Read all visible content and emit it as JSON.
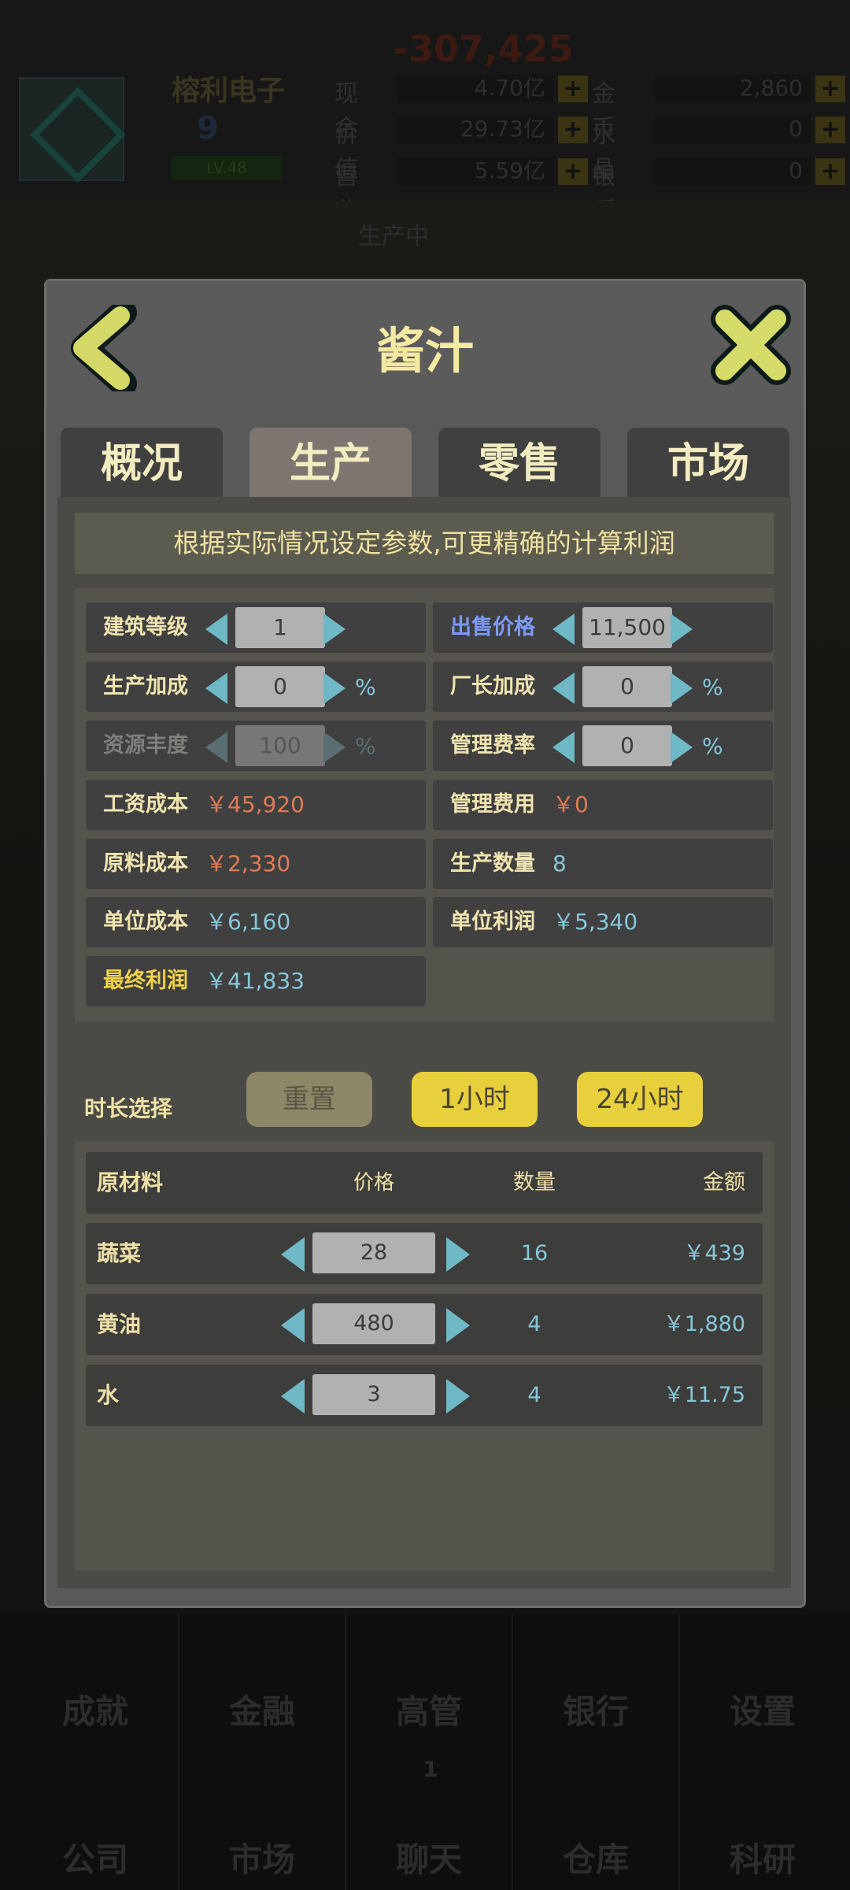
{
  "background": {
    "money": "-307,425",
    "company": "榕利电子",
    "level": "9",
    "level_bar": "LV.48",
    "stats": [
      {
        "label": "现金",
        "value": "4.70亿"
      },
      {
        "label": "价值",
        "value": "29.73亿"
      },
      {
        "label": "营收",
        "value": "5.59亿"
      },
      {
        "label": "金币",
        "value": "2,860"
      },
      {
        "label": "水晶",
        "value": "0"
      },
      {
        "label": "银币",
        "value": "0"
      }
    ],
    "producing": "生产中",
    "nav": [
      "成就",
      "金融",
      "高管",
      "银行",
      "设置",
      "公司",
      "市场",
      "聊天",
      "仓库",
      "科研"
    ],
    "nav_badge": "1"
  },
  "dialog": {
    "title": "酱汁",
    "tabs": [
      {
        "label": "概况",
        "active": false
      },
      {
        "label": "生产",
        "active": true
      },
      {
        "label": "零售",
        "active": false
      },
      {
        "label": "市场",
        "active": false
      }
    ],
    "notice": "根据实际情况设定参数,可更精确的计算利润",
    "params_left": [
      {
        "label": "建筑等级",
        "stepper": "1"
      },
      {
        "label": "生产加成",
        "stepper": "0",
        "unit": "%"
      },
      {
        "label": "资源丰度",
        "stepper": "100",
        "unit": "%"
      },
      {
        "label": "工资成本",
        "value": "￥45,920"
      },
      {
        "label": "原料成本",
        "value": "￥2,330"
      },
      {
        "label": "单位成本",
        "value": "￥6,160"
      },
      {
        "label": "最终利润",
        "value": "￥41,833"
      }
    ],
    "params_right": [
      {
        "label": "出售价格",
        "stepper": "11,500"
      },
      {
        "label": "厂长加成",
        "stepper": "0",
        "unit": "%"
      },
      {
        "label": "管理费率",
        "stepper": "0",
        "unit": "%"
      },
      {
        "label": "管理费用",
        "value": "￥0"
      },
      {
        "label": "生产数量",
        "value": "8"
      },
      {
        "label": "单位利润",
        "value": "￥5,340"
      }
    ],
    "duration": {
      "label": "时长选择",
      "reset": "重置",
      "one_hour": "1小时",
      "day": "24小时"
    },
    "materials": {
      "headers": [
        "原材料",
        "价格",
        "数量",
        "金额"
      ],
      "rows": [
        {
          "name": "蔬菜",
          "price": "28",
          "qty": "16",
          "amount": "￥439"
        },
        {
          "name": "黄油",
          "price": "480",
          "qty": "4",
          "amount": "￥1,880"
        },
        {
          "name": "水",
          "price": "3",
          "qty": "4",
          "amount": "￥11.75"
        }
      ]
    }
  }
}
